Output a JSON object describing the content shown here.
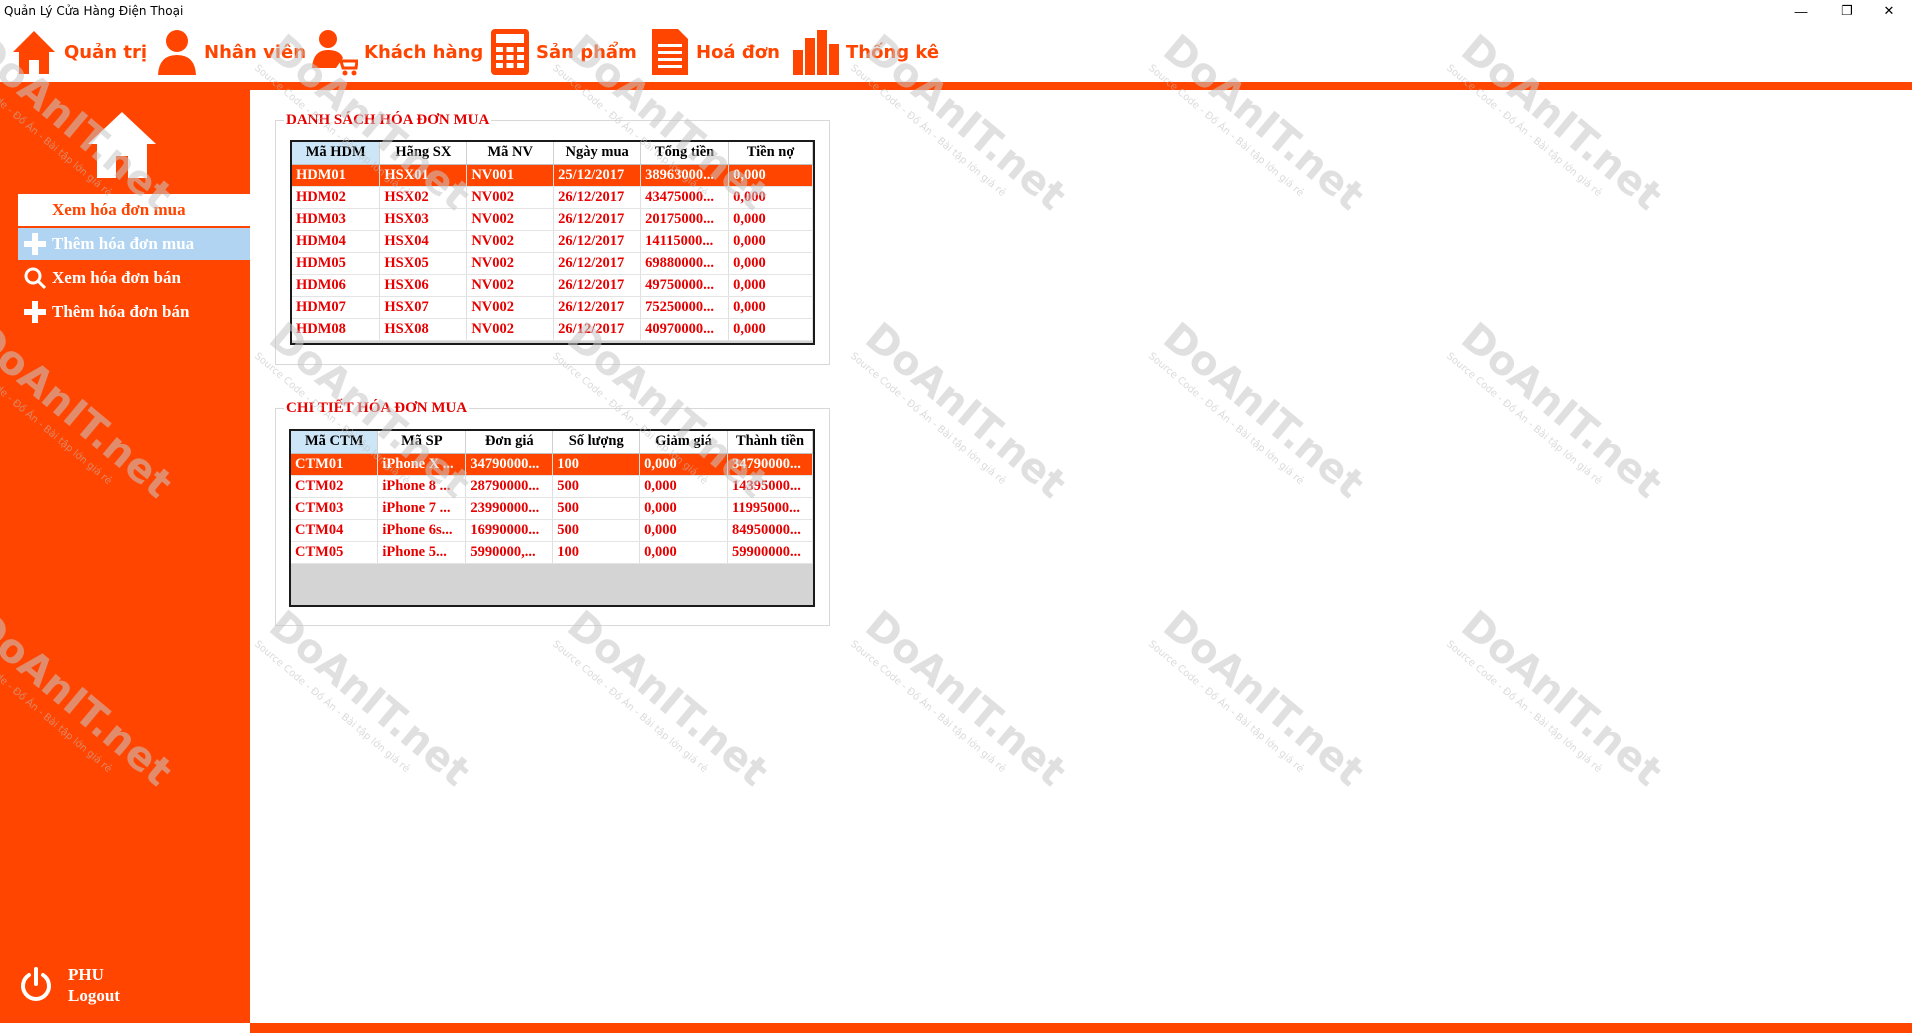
{
  "window": {
    "title": "Quản Lý Cửa Hàng Điện Thoại",
    "minimize_glyph": "—",
    "restore_glyph": "❐",
    "close_glyph": "✕"
  },
  "menu": {
    "items": [
      {
        "label": "Quản trị",
        "icon": "home-icon"
      },
      {
        "label": "Nhân viên",
        "icon": "person-icon"
      },
      {
        "label": "Khách hàng",
        "icon": "customer-cart-icon"
      },
      {
        "label": "Sản phẩm",
        "icon": "calculator-icon"
      },
      {
        "label": "Hoá đơn",
        "icon": "document-icon"
      },
      {
        "label": "Thống kê",
        "icon": "bar-chart-icon"
      }
    ]
  },
  "sidebar": {
    "items": [
      {
        "label": "Xem hóa đơn mua",
        "state": "active"
      },
      {
        "label": "Thêm hóa đơn mua",
        "state": "hover",
        "icon": "plus-icon"
      },
      {
        "label": "Xem hóa đơn bán",
        "state": "normal",
        "icon": "search-icon"
      },
      {
        "label": "Thêm hóa đơn bán",
        "state": "normal",
        "icon": "plus-icon"
      }
    ],
    "user": {
      "name": "PHU",
      "logout_label": "Logout"
    }
  },
  "invoice_list": {
    "title": "DANH SÁCH HÓA ĐƠN MUA",
    "columns": [
      "Mã HDM",
      "Hãng SX",
      "Mã NV",
      "Ngày mua",
      "Tổng tiền",
      "Tiền nợ"
    ],
    "rows": [
      [
        "HDM01",
        "HSX01",
        "NV001",
        "25/12/2017",
        "38963000...",
        "0,000"
      ],
      [
        "HDM02",
        "HSX02",
        "NV002",
        "26/12/2017",
        "43475000...",
        "0,000"
      ],
      [
        "HDM03",
        "HSX03",
        "NV002",
        "26/12/2017",
        "20175000...",
        "0,000"
      ],
      [
        "HDM04",
        "HSX04",
        "NV002",
        "26/12/2017",
        "14115000...",
        "0,000"
      ],
      [
        "HDM05",
        "HSX05",
        "NV002",
        "26/12/2017",
        "69880000...",
        "0,000"
      ],
      [
        "HDM06",
        "HSX06",
        "NV002",
        "26/12/2017",
        "49750000...",
        "0,000"
      ],
      [
        "HDM07",
        "HSX07",
        "NV002",
        "26/12/2017",
        "75250000...",
        "0,000"
      ],
      [
        "HDM08",
        "HSX08",
        "NV002",
        "26/12/2017",
        "40970000...",
        "0,000"
      ]
    ],
    "selected_row": 0
  },
  "invoice_detail": {
    "title": "CHI TIẾT HÓA ĐƠN MUA",
    "columns": [
      "Mã CTM",
      "Mã SP",
      "Đơn giá",
      "Số lượng",
      "Giảm giá",
      "Thành tiền"
    ],
    "rows": [
      [
        "CTM01",
        "iPhone X ...",
        "34790000...",
        "100",
        "0,000",
        "34790000..."
      ],
      [
        "CTM02",
        "iPhone 8 ...",
        "28790000...",
        "500",
        "0,000",
        "14395000..."
      ],
      [
        "CTM03",
        "iPhone 7 ...",
        "23990000...",
        "500",
        "0,000",
        "11995000..."
      ],
      [
        "CTM04",
        "iPhone 6s...",
        "16990000...",
        "500",
        "0,000",
        "84950000..."
      ],
      [
        "CTM05",
        "iPhone 5...",
        "5990000,...",
        "100",
        "0,000",
        "59900000..."
      ]
    ],
    "selected_row": 0
  },
  "watermark": {
    "main": "DoAnIT.net",
    "sub": "Source Code - Đồ Án - Bài tập lớn giá rẻ"
  },
  "colors": {
    "accent": "#ff4500",
    "cell_text": "#e80000",
    "hover": "#b0d4f1"
  }
}
